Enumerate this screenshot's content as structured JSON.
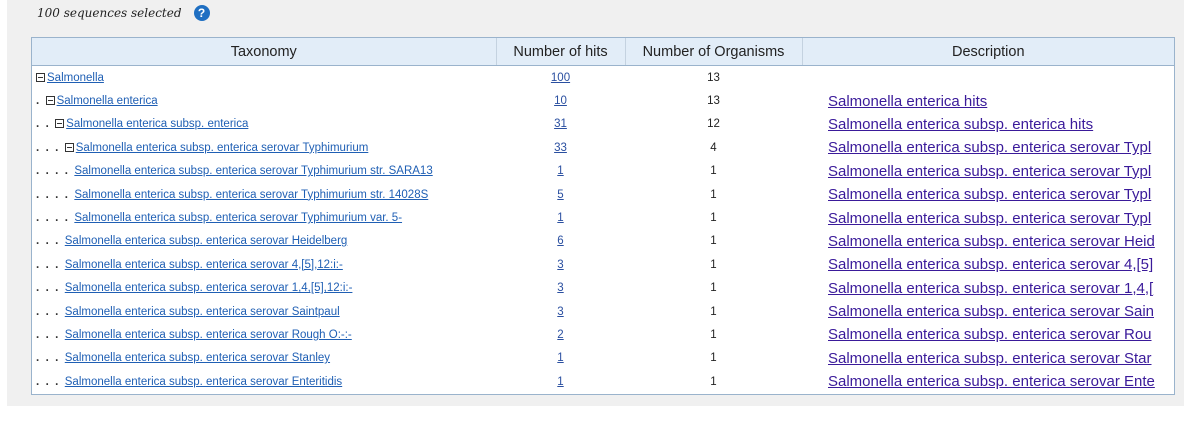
{
  "selection": {
    "text": "100 sequences selected",
    "help_icon": "?"
  },
  "table": {
    "headers": [
      "Taxonomy",
      "Number of hits",
      "Number of Organisms",
      "Description"
    ],
    "rows": [
      {
        "depth": 0,
        "toggle": true,
        "taxonomy": "Salmonella",
        "hits": "100",
        "organisms": "13",
        "description": ""
      },
      {
        "depth": 1,
        "toggle": true,
        "taxonomy": "Salmonella enterica",
        "hits": "10",
        "organisms": "13",
        "description": "Salmonella enterica hits"
      },
      {
        "depth": 2,
        "toggle": true,
        "taxonomy": "Salmonella enterica subsp. enterica",
        "hits": "31",
        "organisms": "12",
        "description": "Salmonella enterica subsp. enterica hits"
      },
      {
        "depth": 3,
        "toggle": true,
        "taxonomy": "Salmonella enterica subsp. enterica serovar Typhimurium",
        "hits": "33",
        "organisms": "4",
        "description": "Salmonella enterica subsp. enterica serovar Typl"
      },
      {
        "depth": 4,
        "toggle": false,
        "taxonomy": "Salmonella enterica subsp. enterica serovar Typhimurium str. SARA13",
        "hits": "1",
        "organisms": "1",
        "description": "Salmonella enterica subsp. enterica serovar Typl"
      },
      {
        "depth": 4,
        "toggle": false,
        "taxonomy": "Salmonella enterica subsp. enterica serovar Typhimurium str. 14028S",
        "hits": "5",
        "organisms": "1",
        "description": "Salmonella enterica subsp. enterica serovar Typl"
      },
      {
        "depth": 4,
        "toggle": false,
        "taxonomy": "Salmonella enterica subsp. enterica serovar Typhimurium var. 5-",
        "hits": "1",
        "organisms": "1",
        "description": "Salmonella enterica subsp. enterica serovar Typl"
      },
      {
        "depth": 3,
        "toggle": false,
        "taxonomy": "Salmonella enterica subsp. enterica serovar Heidelberg",
        "hits": "6",
        "organisms": "1",
        "description": "Salmonella enterica subsp. enterica serovar Heid"
      },
      {
        "depth": 3,
        "toggle": false,
        "taxonomy": "Salmonella enterica subsp. enterica serovar 4,[5],12:i:-",
        "hits": "3",
        "organisms": "1",
        "description": "Salmonella enterica subsp. enterica serovar 4,[5]"
      },
      {
        "depth": 3,
        "toggle": false,
        "taxonomy": "Salmonella enterica subsp. enterica serovar 1,4,[5],12:i:-",
        "hits": "3",
        "organisms": "1",
        "description": "Salmonella enterica subsp. enterica serovar 1,4,["
      },
      {
        "depth": 3,
        "toggle": false,
        "taxonomy": "Salmonella enterica subsp. enterica serovar Saintpaul",
        "hits": "3",
        "organisms": "1",
        "description": "Salmonella enterica subsp. enterica serovar Sain"
      },
      {
        "depth": 3,
        "toggle": false,
        "taxonomy": "Salmonella enterica subsp. enterica serovar Rough O:-:-",
        "hits": "2",
        "organisms": "1",
        "description": "Salmonella enterica subsp. enterica serovar Rou"
      },
      {
        "depth": 3,
        "toggle": false,
        "taxonomy": "Salmonella enterica subsp. enterica serovar Stanley",
        "hits": "1",
        "organisms": "1",
        "description": "Salmonella enterica subsp. enterica serovar Star"
      },
      {
        "depth": 3,
        "toggle": false,
        "taxonomy": "Salmonella enterica subsp. enterica serovar Enteritidis",
        "hits": "1",
        "organisms": "1",
        "description": "Salmonella enterica subsp. enterica serovar Ente"
      }
    ]
  }
}
